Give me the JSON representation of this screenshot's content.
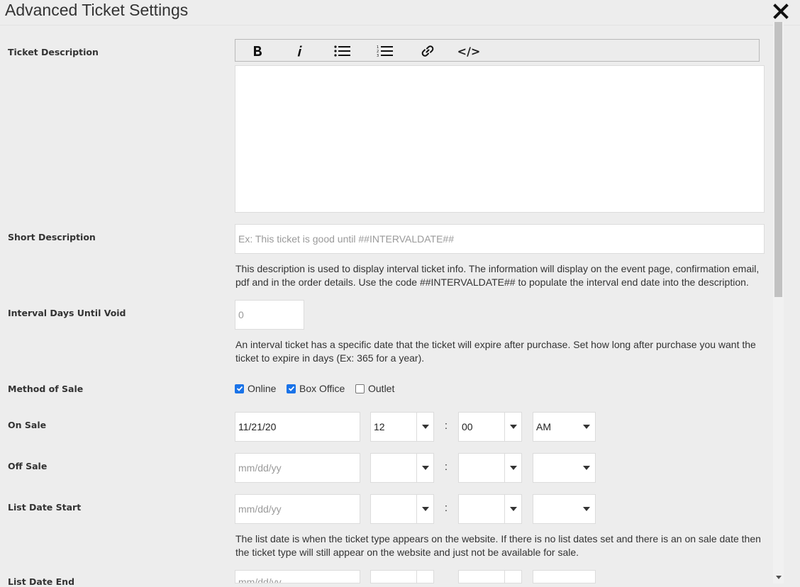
{
  "dialog": {
    "title": "Advanced Ticket Settings"
  },
  "labels": {
    "ticket_description": "Ticket Description",
    "short_description": "Short Description",
    "interval_days": "Interval Days Until Void",
    "method_of_sale": "Method of Sale",
    "on_sale": "On Sale",
    "off_sale": "Off Sale",
    "list_date_start": "List Date Start",
    "list_date_end": "List Date End"
  },
  "toolbar": {
    "icons": [
      "bold-icon",
      "italic-icon",
      "bulleted-list-icon",
      "numbered-list-icon",
      "link-icon",
      "code-icon"
    ],
    "code_label": "</>"
  },
  "short_description": {
    "placeholder": "Ex: This ticket is good until ##INTERVALDATE##",
    "help": "This description is used to display interval ticket info. The information will display on the event page, confirmation email, pdf and in the order details. Use the code ##INTERVALDATE## to populate the interval end date into the description."
  },
  "interval_days": {
    "placeholder": "0",
    "help": "An interval ticket has a specific date that the ticket will expire after purchase. Set how long after purchase you want the ticket to expire in days (Ex: 365 for a year)."
  },
  "method_of_sale": [
    {
      "label": "Online",
      "checked": true
    },
    {
      "label": "Box Office",
      "checked": true
    },
    {
      "label": "Outlet",
      "checked": false
    }
  ],
  "on_sale": {
    "date": "11/21/20",
    "hour": "12",
    "minute": "00",
    "ampm": "AM"
  },
  "off_sale": {
    "date_placeholder": "mm/dd/yy",
    "hour": "",
    "minute": "",
    "ampm": ""
  },
  "list_date_start": {
    "date_placeholder": "mm/dd/yy",
    "hour": "",
    "minute": "",
    "ampm": "",
    "help": "The list date is when the ticket type appears on the website. If there is no list dates set and there is an on sale date then the ticket type will still appear on the website and just not be available for sale."
  },
  "list_date_end": {
    "date_placeholder": "mm/dd/yy"
  },
  "time_separator": ":",
  "colors": {
    "checkbox_accent": "#1a73e8",
    "background": "#ededed"
  }
}
